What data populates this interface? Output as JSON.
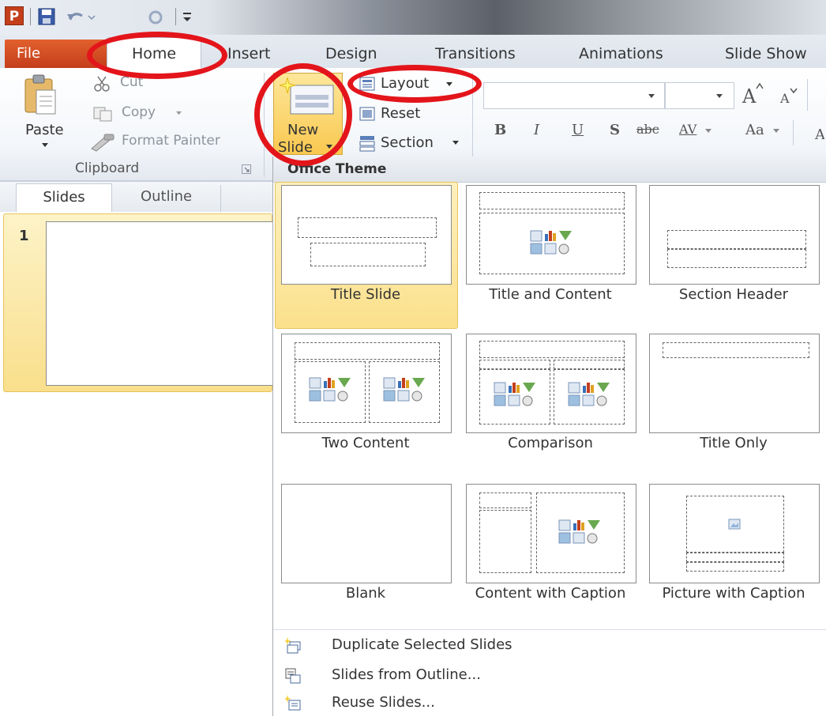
{
  "quick_access": {
    "logo_letter": "P"
  },
  "tabs": [
    {
      "label": "File"
    },
    {
      "label": "Home"
    },
    {
      "label": "Insert"
    },
    {
      "label": "Design"
    },
    {
      "label": "Transitions"
    },
    {
      "label": "Animations"
    },
    {
      "label": "Slide Show"
    }
  ],
  "clipboard": {
    "paste": "Paste",
    "cut": "Cut",
    "copy": "Copy",
    "format_painter": "Format Painter",
    "group_label": "Clipboard"
  },
  "slides": {
    "new_slide_line1": "New",
    "new_slide_line2": "Slide",
    "layout": "Layout",
    "reset": "Reset",
    "section": "Section"
  },
  "font": {
    "bold": "B",
    "italic": "I",
    "underline": "U",
    "shadow": "S",
    "strike": "abc",
    "spacing": "AV",
    "case": "Aa"
  },
  "panel": {
    "tab_slides": "Slides",
    "tab_outline": "Outline",
    "slide_number": "1"
  },
  "dropdown": {
    "title": "Office Theme",
    "layouts": [
      {
        "label": "Title Slide"
      },
      {
        "label": "Title and Content"
      },
      {
        "label": "Section Header"
      },
      {
        "label": "Two Content"
      },
      {
        "label": "Comparison"
      },
      {
        "label": "Title Only"
      },
      {
        "label": "Blank"
      },
      {
        "label": "Content with Caption"
      },
      {
        "label": "Picture with Caption"
      }
    ],
    "commands": [
      {
        "label": "Duplicate Selected Slides"
      },
      {
        "label": "Slides from Outline..."
      },
      {
        "label": "Reuse Slides..."
      }
    ]
  },
  "colors": {
    "file_tab": "#c43e1c",
    "highlight": "#e3151b",
    "selection": "#fbe08c"
  }
}
